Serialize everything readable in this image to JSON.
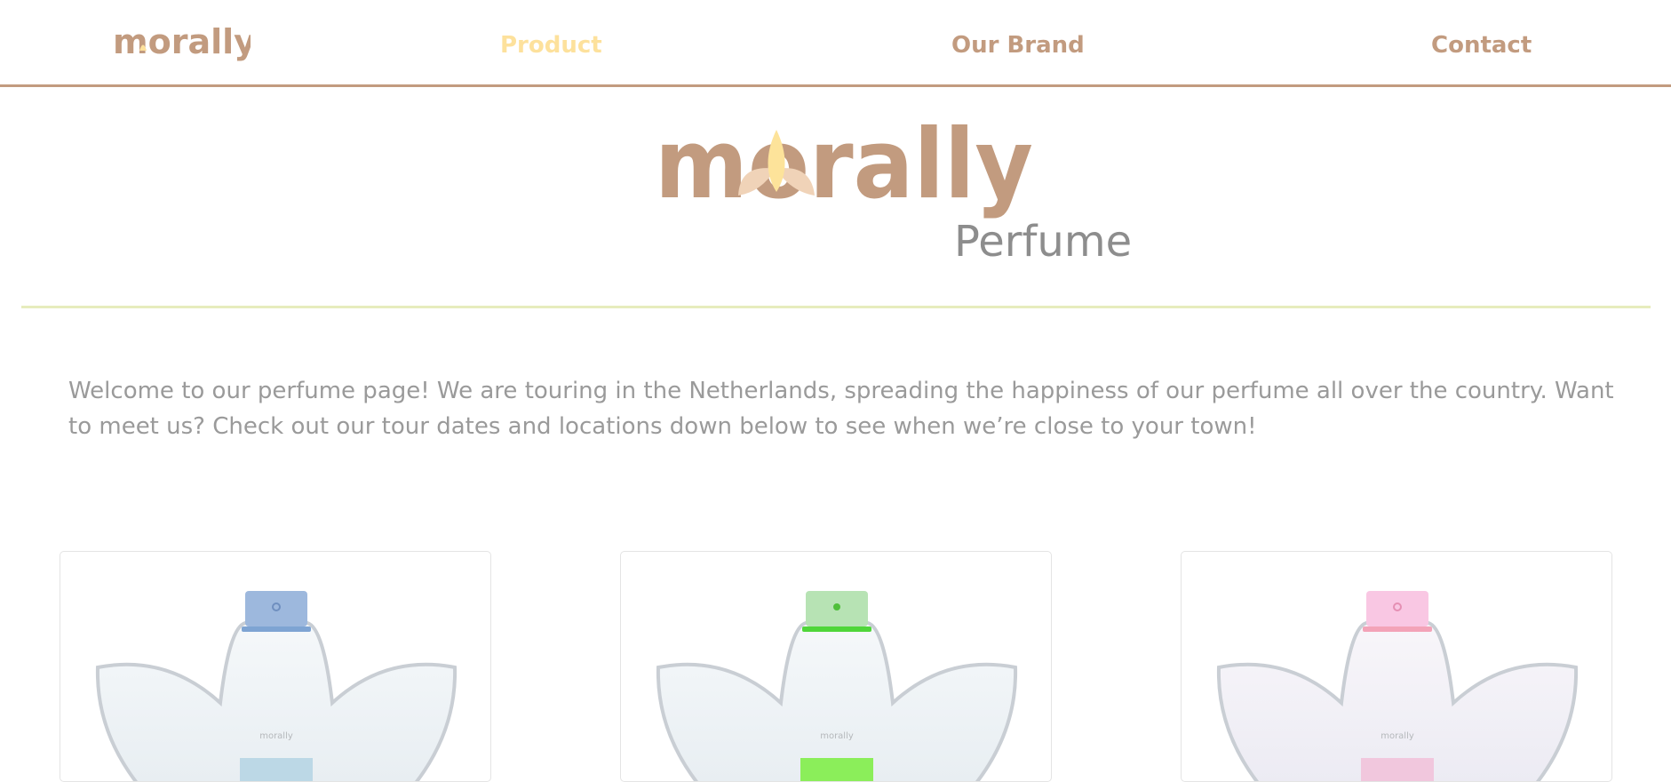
{
  "nav": {
    "logo_text": "morally",
    "links": [
      {
        "label": "Product",
        "active": true
      },
      {
        "label": "Our Brand",
        "active": false
      },
      {
        "label": "Contact",
        "active": false
      }
    ]
  },
  "hero": {
    "logo_text": "morally",
    "subtitle": "Perfume"
  },
  "intro": {
    "text": "Welcome to our perfume page! We are touring in the Netherlands, spreading the happiness of our perfume all over the country. Want to meet us? Check out our tour dates and locations down below to see when we’re close to your town!"
  },
  "products": [
    {
      "bottle_label": "morally",
      "accent_color": "#9db8dd",
      "band_color": "#bcd8e6"
    },
    {
      "bottle_label": "morally",
      "accent_color": "#8fe07f",
      "band_color": "#8bee5a"
    },
    {
      "bottle_label": "morally",
      "accent_color": "#f7b9d8",
      "band_color": "#f1c7dd"
    }
  ],
  "colors": {
    "brand": "#c29b7f",
    "active_link": "#fde19c",
    "divider": "#e7ecbd",
    "text_gray": "#9a9a9a"
  }
}
